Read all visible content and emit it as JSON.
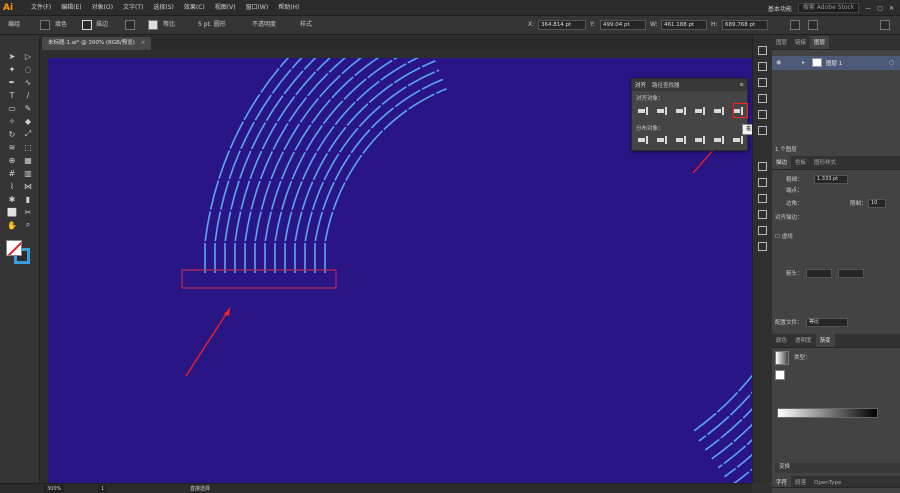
{
  "app": {
    "logo": "Ai"
  },
  "menu": {
    "items": [
      "文件(F)",
      "编辑(E)",
      "对象(O)",
      "文字(T)",
      "选择(S)",
      "效果(C)",
      "视图(V)",
      "窗口(W)",
      "帮助(H)"
    ],
    "workspace": "基本功能",
    "search_placeholder": "搜索 Adobe Stock"
  },
  "control": {
    "selection_label": "编组",
    "stroke_label": "描边",
    "fill_label": "填色",
    "uniform_label": "等比",
    "width_label": "5 pt. 圆形",
    "opacity_label": "不透明度",
    "style_label": "样式",
    "x_label": "X:",
    "x_value": "364.814 pt",
    "y_label": "Y:",
    "y_value": "499.04 pt",
    "w_label": "W:",
    "w_value": "461.188 pt",
    "h_label": "H:",
    "h_value": "689.768 pt"
  },
  "document": {
    "tab_title": "未标题-1.ai* @ 300% (RGB/预览)",
    "close": "×"
  },
  "align_panel": {
    "tab_align": "对齐",
    "tab_pathfinder": "路径查找器",
    "align_objects_label": "对齐对象：",
    "distribute_objects_label": "分布对象："
  },
  "tooltip": {
    "text": "垂直底对齐"
  },
  "statusbar": {
    "zoom": "300%",
    "page": "1",
    "tool_label": "直接选择"
  },
  "layers_panel": {
    "tabs": [
      "图层",
      "链接",
      "图层"
    ],
    "layer_name": "图层 1",
    "layer_count": "1 个图层"
  },
  "appearance_panel": {
    "tabs": [
      "描边",
      "色板",
      "图形样式"
    ],
    "weight_label": "粗细：",
    "weight_value": "1.333 pt",
    "cap_label": "端点：",
    "corner_label": "边角：",
    "limit_label": "限制：",
    "limit_value": "10",
    "align_stroke_label": "对齐描边：",
    "dashed_label": "虚线",
    "arrow_label": "箭头：",
    "profile_label": "配置文件：",
    "profile_value": "等比"
  },
  "gradient_panel": {
    "tabs": [
      "颜色",
      "透明度",
      "渐变"
    ],
    "type_label": "类型："
  },
  "bottom_panels": {
    "transform": "变换",
    "char_tabs": [
      "字符",
      "段落",
      "OpenType"
    ]
  },
  "colors": {
    "canvas": "#2a1585",
    "line": "#5aa8f0",
    "arrow": "#ff2020",
    "tooltip_bg": "#f2f2f2"
  }
}
